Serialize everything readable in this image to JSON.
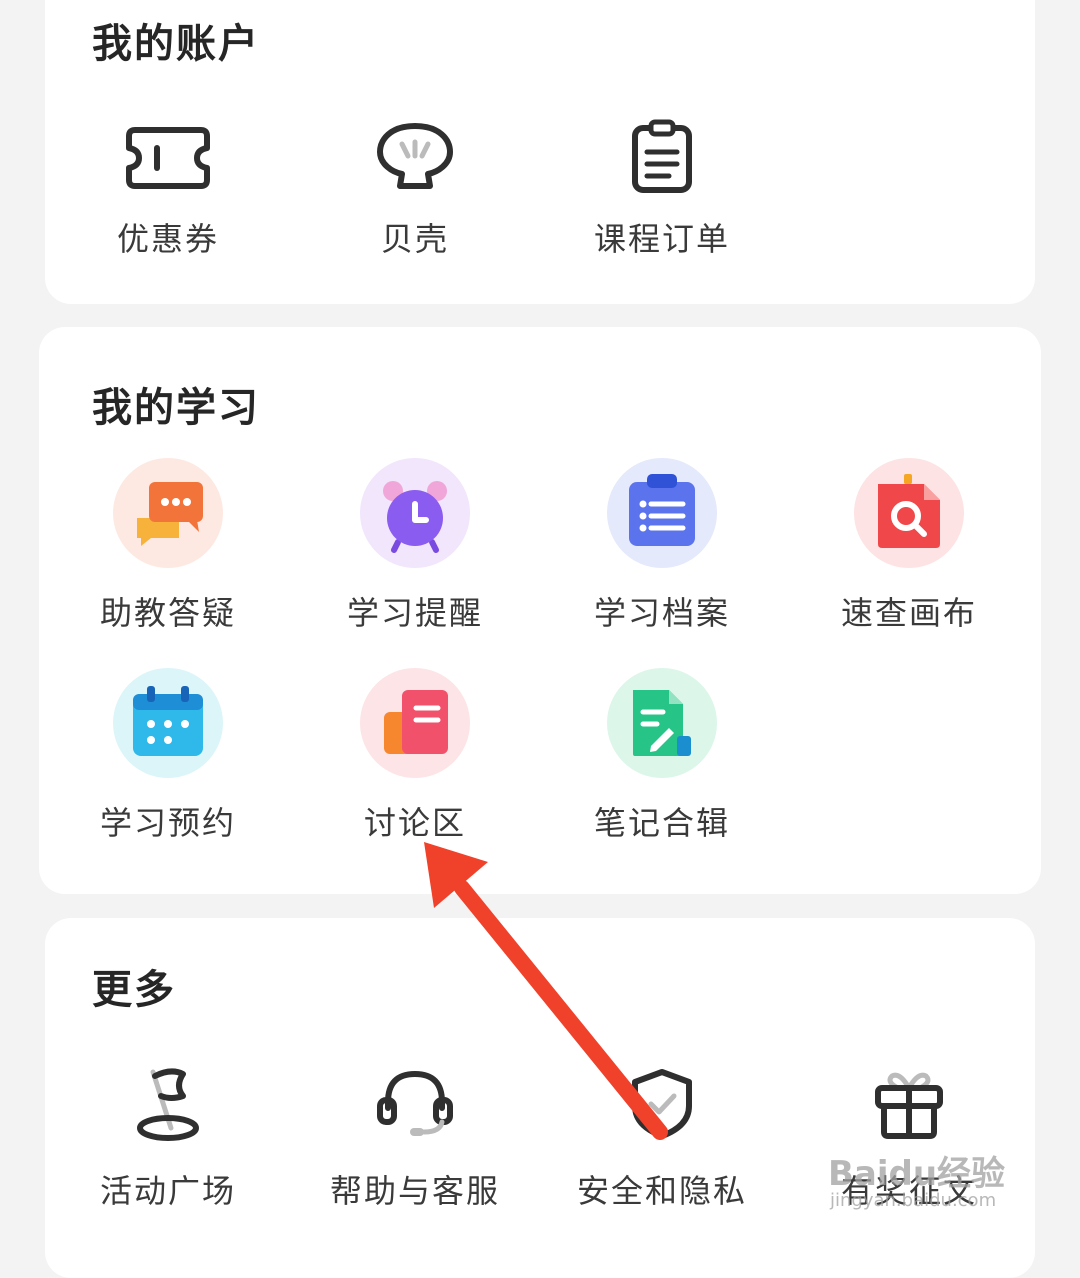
{
  "account": {
    "title": "我的账户",
    "items": [
      {
        "label": "优惠券",
        "icon": "coupon-icon"
      },
      {
        "label": "贝壳",
        "icon": "shell-icon"
      },
      {
        "label": "课程订单",
        "icon": "order-clipboard-icon"
      }
    ]
  },
  "study": {
    "title": "我的学习",
    "items": [
      {
        "label": "助教答疑",
        "icon": "chat-bubbles-icon",
        "bg": "#fde9e2"
      },
      {
        "label": "学习提醒",
        "icon": "alarm-clock-icon",
        "bg": "#f1e6fb"
      },
      {
        "label": "学习档案",
        "icon": "clipboard-list-icon",
        "bg": "#e4e9fb"
      },
      {
        "label": "速查画布",
        "icon": "search-document-icon",
        "bg": "#fde3e3"
      },
      {
        "label": "学习预约",
        "icon": "calendar-icon",
        "bg": "#dcf5f8"
      },
      {
        "label": "讨论区",
        "icon": "discussion-cards-icon",
        "bg": "#fde4e6"
      },
      {
        "label": "笔记合辑",
        "icon": "note-edit-icon",
        "bg": "#dcf6ea"
      }
    ]
  },
  "more": {
    "title": "更多",
    "items": [
      {
        "label": "活动广场",
        "icon": "flag-icon"
      },
      {
        "label": "帮助与客服",
        "icon": "headset-icon"
      },
      {
        "label": "安全和隐私",
        "icon": "shield-check-icon"
      },
      {
        "label": "有奖征文",
        "icon": "gift-icon"
      }
    ]
  },
  "watermark": {
    "brand": "Baidu经验",
    "url": "jingyan.baidu.com"
  },
  "colors": {
    "arrow": "#f0412b",
    "icon_stroke": "#2f2f2f"
  }
}
